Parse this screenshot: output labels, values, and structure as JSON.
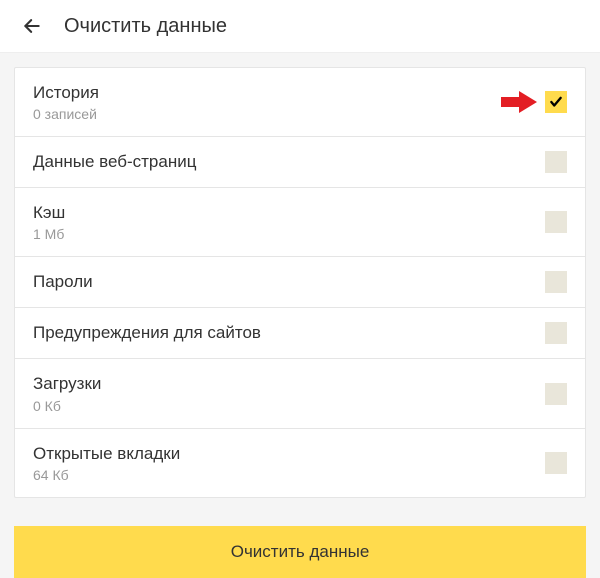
{
  "header": {
    "title": "Очистить данные"
  },
  "items": [
    {
      "title": "История",
      "subtitle": "0 записей",
      "checked": true,
      "hasArrow": true
    },
    {
      "title": "Данные веб-страниц",
      "subtitle": "",
      "checked": false,
      "hasArrow": false
    },
    {
      "title": "Кэш",
      "subtitle": "1 Мб",
      "checked": false,
      "hasArrow": false
    },
    {
      "title": "Пароли",
      "subtitle": "",
      "checked": false,
      "hasArrow": false
    },
    {
      "title": "Предупреждения для сайтов",
      "subtitle": "",
      "checked": false,
      "hasArrow": false
    },
    {
      "title": "Загрузки",
      "subtitle": "0 Кб",
      "checked": false,
      "hasArrow": false
    },
    {
      "title": "Открытые вкладки",
      "subtitle": "64 Кб",
      "checked": false,
      "hasArrow": false
    }
  ],
  "button": {
    "label": "Очистить данные"
  },
  "colors": {
    "accent": "#ffdb4d",
    "arrowIndicator": "#e31e24"
  }
}
